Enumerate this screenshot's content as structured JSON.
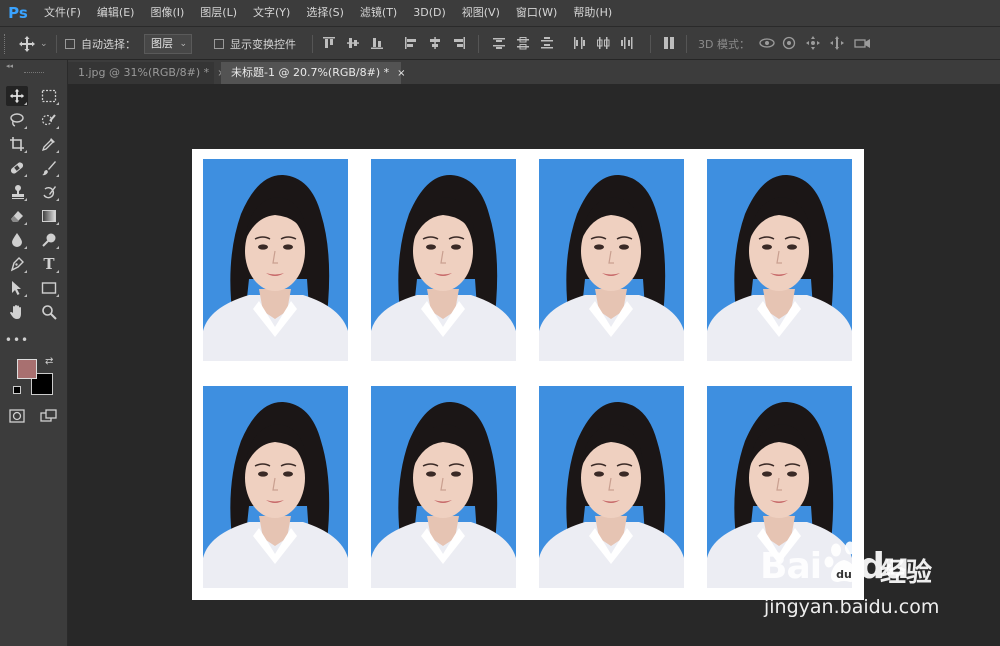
{
  "app": {
    "logo_text": "Ps"
  },
  "menu": [
    "文件(F)",
    "编辑(E)",
    "图像(I)",
    "图层(L)",
    "文字(Y)",
    "选择(S)",
    "滤镜(T)",
    "3D(D)",
    "视图(V)",
    "窗口(W)",
    "帮助(H)"
  ],
  "options_bar": {
    "auto_select_label": "自动选择：",
    "auto_select_target": "图层",
    "show_transform_label": "显示变换控件",
    "mode_3d_label": "3D 模式："
  },
  "tabs": [
    {
      "label": "1.jpg @ 31%(RGB/8#) *",
      "close": "×"
    },
    {
      "label": "未标题-1 @ 20.7%(RGB/8#) *",
      "close": "×"
    }
  ],
  "toolbox": {
    "foreground_color": "#a87070",
    "background_color": "#000000"
  },
  "canvas": {
    "background": "#ffffff",
    "photo_background": "#3e8fe0",
    "grid_rows": 2,
    "grid_cols": 4
  },
  "watermark": {
    "brand": "Bai",
    "brand_suffix": "du",
    "service": "经验",
    "url": "jingyan.baidu.com"
  }
}
